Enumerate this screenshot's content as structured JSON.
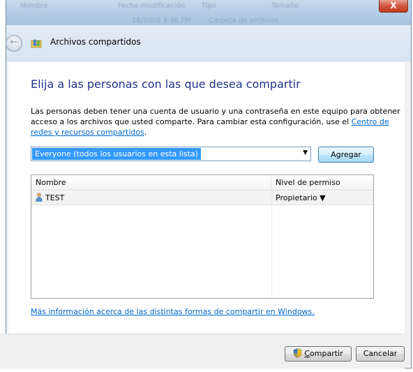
{
  "window": {
    "title": "Archivos compartidos",
    "close_label": "X"
  },
  "background_columns": [
    "Nombre",
    "Fecha modificación",
    "Tipo",
    "Tamaño"
  ],
  "background_row": [
    "16/2006 9:46 PM",
    "Carpeta de archivos"
  ],
  "dialog": {
    "heading": "Elija a las personas con las que desea compartir",
    "description_text": "Las personas deben tener una cuenta de usuario y una contraseña en este equipo para obtener acceso a los archivos que usted comparte. Para cambiar esta configuración, use el ",
    "description_link": "Centro de redes y recursos compartidos",
    "description_end": ".",
    "combo_value": "Everyone (todos los usuarios en esta lista)",
    "add_button": "Agregar",
    "table": {
      "col_name": "Nombre",
      "col_permission": "Nivel de permiso",
      "rows": [
        {
          "name": "TEST",
          "permission": "Propietario ▼"
        }
      ]
    },
    "more_info_link": "Más información acerca de las distintas formas de compartir en Windows."
  },
  "footer": {
    "share_button_accel": "C",
    "share_button_rest": "ompartir",
    "cancel_button": "Cancelar"
  },
  "icons": {
    "back": "back-arrow-icon",
    "header": "shared-folder-users-icon",
    "user": "user-icon",
    "shield": "uac-shield-icon"
  },
  "colors": {
    "heading": "#1e3287",
    "link": "#0066cc",
    "selection": "#3399ff"
  }
}
